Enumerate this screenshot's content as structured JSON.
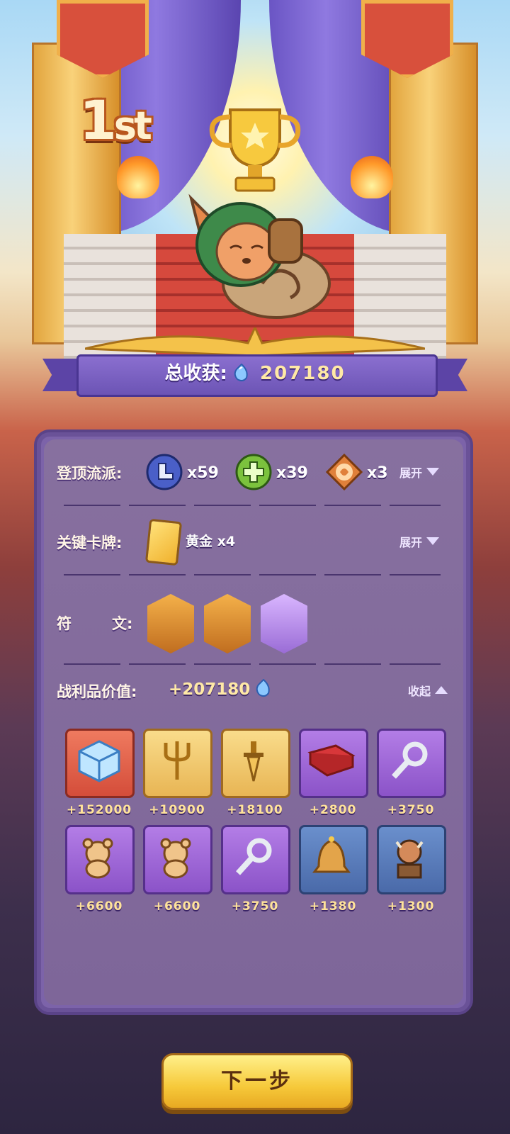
{
  "rank": {
    "main": "1",
    "suffix": "st"
  },
  "total": {
    "label": "总收获:",
    "value": "207180",
    "currency_icon": "blue-gem-icon"
  },
  "panel": {
    "genre": {
      "label": "登顶流派:",
      "items": [
        {
          "icon": "boot-badge-icon",
          "count": "x59",
          "color": "#4a5fc8"
        },
        {
          "icon": "green-cross-badge-icon",
          "count": "x39",
          "color": "#7bc23d"
        },
        {
          "icon": "orange-swirl-badge-icon",
          "count": "x3",
          "color": "#e0803a"
        }
      ],
      "toggle": "展开"
    },
    "key_cards": {
      "label": "关键卡牌:",
      "card_name": "黄金",
      "card_count": "x4",
      "toggle": "展开"
    },
    "runes": {
      "label_1": "符",
      "label_2": "文:",
      "items": [
        {
          "icon": "running-figure-rune-icon",
          "color": "#d98a2e"
        },
        {
          "icon": "treasure-chest-rune-icon",
          "color": "#d98a2e"
        },
        {
          "icon": "ring-rune-icon",
          "color": "#b28bd9"
        }
      ]
    },
    "loot": {
      "label": "战利品价值:",
      "value": "+207180",
      "toggle": "收起",
      "items": [
        {
          "icon": "ice-cube-icon",
          "rarity": "red",
          "value": "+152000"
        },
        {
          "icon": "golden-trident-icon",
          "rarity": "gold",
          "value": "+10900"
        },
        {
          "icon": "golden-dagger-icon",
          "rarity": "gold",
          "value": "+18100"
        },
        {
          "icon": "red-book-icon",
          "rarity": "purple",
          "value": "+2800"
        },
        {
          "icon": "silver-key-icon",
          "rarity": "purple",
          "value": "+3750"
        },
        {
          "icon": "teddy-bear-icon",
          "rarity": "purple",
          "value": "+6600"
        },
        {
          "icon": "teddy-bear-icon",
          "rarity": "purple",
          "value": "+6600"
        },
        {
          "icon": "silver-key-icon",
          "rarity": "purple",
          "value": "+3750"
        },
        {
          "icon": "bronze-bell-icon",
          "rarity": "blue",
          "value": "+1380"
        },
        {
          "icon": "bull-statue-icon",
          "rarity": "blue",
          "value": "+1300"
        }
      ]
    }
  },
  "next_button": "下一步"
}
